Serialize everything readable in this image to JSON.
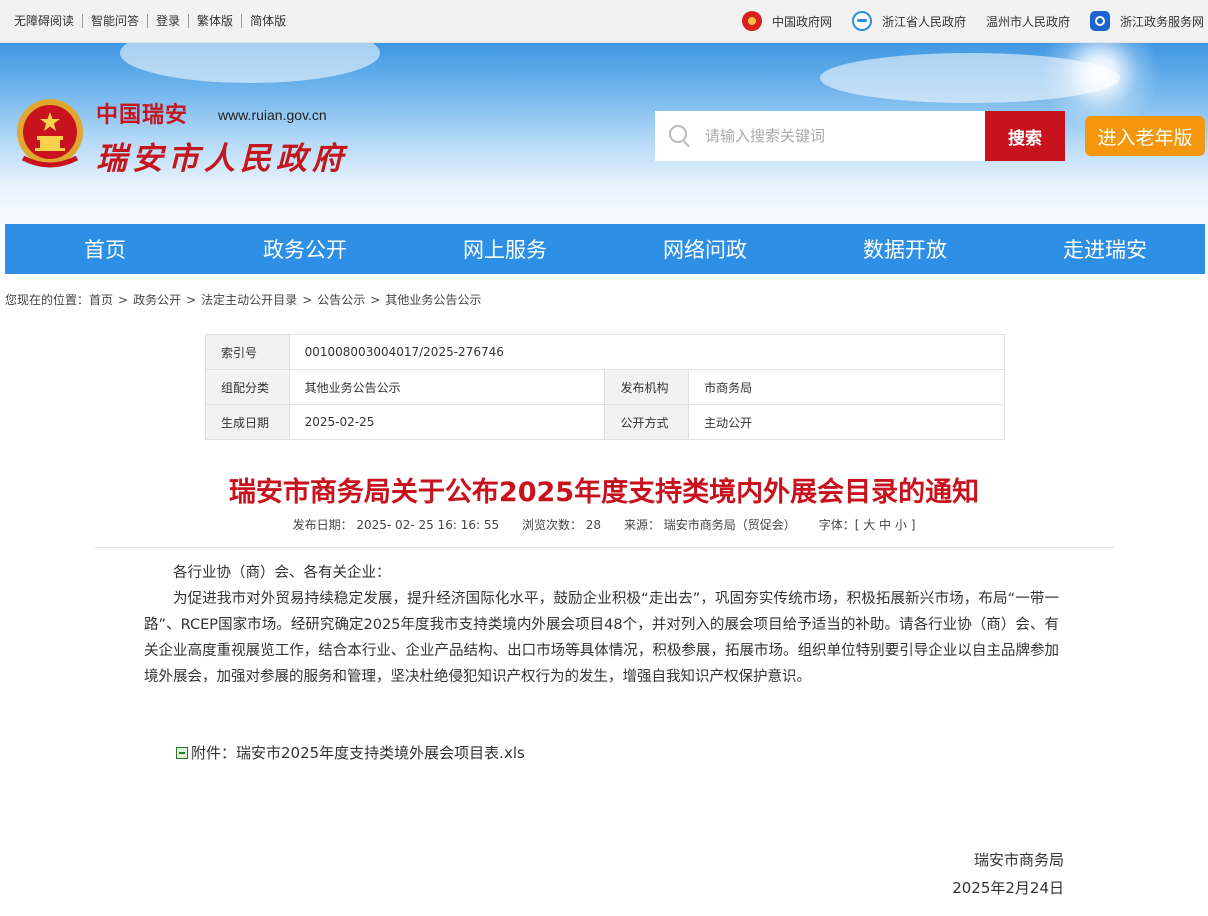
{
  "topbar": {
    "left_links": [
      "无障碍阅读",
      "智能问答",
      "登录",
      "繁体版",
      "简体版"
    ],
    "right_links": [
      {
        "label": "中国政府网",
        "icon": "national-emblem-icon"
      },
      {
        "label": "浙江省人民政府",
        "icon": "zhejiang-gov-icon"
      },
      {
        "label": "温州市人民政府",
        "icon": ""
      },
      {
        "label": "浙江政务服务网",
        "icon": "service-net-icon"
      }
    ]
  },
  "header": {
    "logo_small": "中国瑞安",
    "logo_url": "www.ruian.gov.cn",
    "logo_big": "瑞安市人民政府",
    "search_placeholder": "请输入搜索关键词",
    "search_button": "搜索",
    "elder_button": "进入老年版"
  },
  "nav": [
    "首页",
    "政务公开",
    "网上服务",
    "网络问政",
    "数据开放",
    "走进瑞安"
  ],
  "breadcrumb": {
    "prefix": "您现在的位置：",
    "items": [
      "首页",
      "政务公开",
      "法定主动公开目录",
      "公告公示",
      "其他业务公告公示"
    ],
    "separator": ">"
  },
  "info": {
    "index_label": "索引号",
    "index_value": "001008003004017/2025-276746",
    "category_label": "组配分类",
    "category_value": "其他业务公告公示",
    "publisher_label": "发布机构",
    "publisher_value": "市商务局",
    "date_label": "生成日期",
    "date_value": "2025-02-25",
    "method_label": "公开方式",
    "method_value": "主动公开"
  },
  "article": {
    "title": "瑞安市商务局关于公布2025年度支持类境内外展会目录的通知",
    "meta_publish": "发布日期： 2025- 02- 25 16: 16: 55",
    "meta_views": "浏览次数： 28",
    "meta_source": "来源： 瑞安市商务局（贸促会）",
    "meta_font_label": "字体：[",
    "font_sizes": [
      "大",
      "中",
      "小"
    ],
    "meta_font_close": "]",
    "salutation": "各行业协（商）会、各有关企业：",
    "paragraph": "为促进我市对外贸易持续稳定发展，提升经济国际化水平，鼓励企业积极“走出去”，巩固夯实传统市场，积极拓展新兴市场，布局“一带一路”、RCEP国家市场。经研究确定2025年度我市支持类境内外展会项目48个，并对列入的展会项目给予适当的补助。请各行业协（商）会、有关企业高度重视展览工作，结合本行业、企业产品结构、出口市场等具体情况，积极参展，拓展市场。组织单位特别要引导企业以自主品牌参加境外展会，加强对参展的服务和管理，坚决杜绝侵犯知识产权行为的发生，增强自我知识产权保护意识。",
    "attachment": "附件：瑞安市2025年度支持类境外展会项目表.xls",
    "signer": "瑞安市商务局",
    "sign_date": "2025年2月24日"
  }
}
